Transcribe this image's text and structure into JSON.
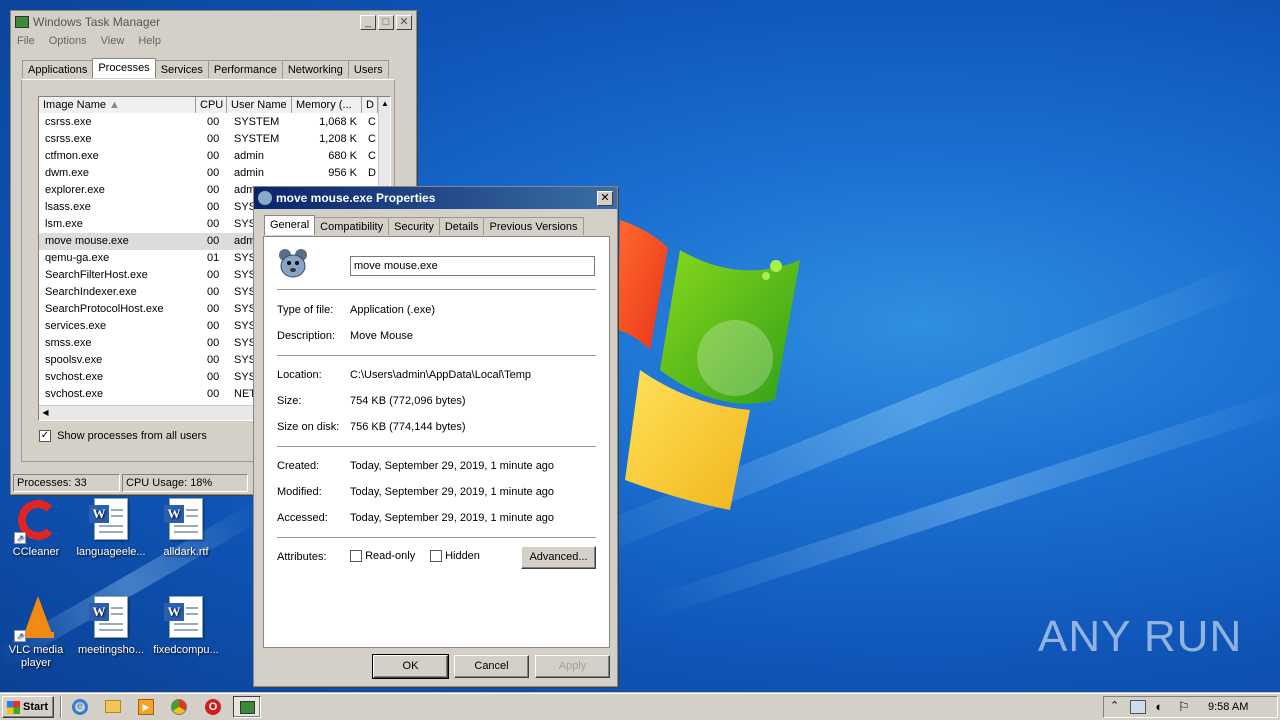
{
  "desktop": {
    "icons": [
      {
        "label": "CCleaner"
      },
      {
        "label": "languageele..."
      },
      {
        "label": "alldark.rtf"
      },
      {
        "label": "VLC media player"
      },
      {
        "label": "meetingsho..."
      },
      {
        "label": "fixedcompu..."
      }
    ],
    "watermark": "ANY RUN"
  },
  "taskmgr": {
    "title": "Windows Task Manager",
    "menu": [
      "File",
      "Options",
      "View",
      "Help"
    ],
    "tabs": [
      "Applications",
      "Processes",
      "Services",
      "Performance",
      "Networking",
      "Users"
    ],
    "active_tab": "Processes",
    "columns": [
      "Image Name",
      "CPU",
      "User Name",
      "Memory (...",
      "D"
    ],
    "rows": [
      {
        "name": "csrss.exe",
        "cpu": "00",
        "user": "SYSTEM",
        "mem": "1,068 K",
        "d": "C"
      },
      {
        "name": "csrss.exe",
        "cpu": "00",
        "user": "SYSTEM",
        "mem": "1,208 K",
        "d": "C"
      },
      {
        "name": "ctfmon.exe",
        "cpu": "00",
        "user": "admin",
        "mem": "680 K",
        "d": "C"
      },
      {
        "name": "dwm.exe",
        "cpu": "00",
        "user": "admin",
        "mem": "956 K",
        "d": "D"
      },
      {
        "name": "explorer.exe",
        "cpu": "00",
        "user": "adm",
        "mem": "",
        "d": ""
      },
      {
        "name": "lsass.exe",
        "cpu": "00",
        "user": "SYS",
        "mem": "",
        "d": ""
      },
      {
        "name": "lsm.exe",
        "cpu": "00",
        "user": "SYS",
        "mem": "",
        "d": ""
      },
      {
        "name": "move mouse.exe",
        "cpu": "00",
        "user": "adm",
        "mem": "",
        "d": ""
      },
      {
        "name": "qemu-ga.exe",
        "cpu": "01",
        "user": "SYS",
        "mem": "",
        "d": ""
      },
      {
        "name": "SearchFilterHost.exe",
        "cpu": "00",
        "user": "SYS",
        "mem": "",
        "d": ""
      },
      {
        "name": "SearchIndexer.exe",
        "cpu": "00",
        "user": "SYS",
        "mem": "",
        "d": ""
      },
      {
        "name": "SearchProtocolHost.exe",
        "cpu": "00",
        "user": "SYS",
        "mem": "",
        "d": ""
      },
      {
        "name": "services.exe",
        "cpu": "00",
        "user": "SYS",
        "mem": "",
        "d": ""
      },
      {
        "name": "smss.exe",
        "cpu": "00",
        "user": "SYS",
        "mem": "",
        "d": ""
      },
      {
        "name": "spoolsv.exe",
        "cpu": "00",
        "user": "SYS",
        "mem": "",
        "d": ""
      },
      {
        "name": "svchost.exe",
        "cpu": "00",
        "user": "SYS",
        "mem": "",
        "d": ""
      },
      {
        "name": "svchost.exe",
        "cpu": "00",
        "user": "NET",
        "mem": "",
        "d": ""
      }
    ],
    "selected_row": 7,
    "show_all_label": "Show processes from all users",
    "status_processes": "Processes: 33",
    "status_cpu": "CPU Usage: 18%"
  },
  "props": {
    "title": "move mouse.exe Properties",
    "tabs": [
      "General",
      "Compatibility",
      "Security",
      "Details",
      "Previous Versions"
    ],
    "filename": "move mouse.exe",
    "fields1": [
      {
        "label": "Type of file:",
        "value": "Application (.exe)"
      },
      {
        "label": "Description:",
        "value": "Move Mouse"
      }
    ],
    "fields2": [
      {
        "label": "Location:",
        "value": "C:\\Users\\admin\\AppData\\Local\\Temp"
      },
      {
        "label": "Size:",
        "value": "754 KB (772,096 bytes)"
      },
      {
        "label": "Size on disk:",
        "value": "756 KB (774,144 bytes)"
      }
    ],
    "fields3": [
      {
        "label": "Created:",
        "value": "Today, September 29, 2019, 1 minute ago"
      },
      {
        "label": "Modified:",
        "value": "Today, September 29, 2019, 1 minute ago"
      },
      {
        "label": "Accessed:",
        "value": "Today, September 29, 2019, 1 minute ago"
      }
    ],
    "attributes_label": "Attributes:",
    "readonly_label": "Read-only",
    "hidden_label": "Hidden",
    "advanced_label": "Advanced...",
    "ok_label": "OK",
    "cancel_label": "Cancel",
    "apply_label": "Apply"
  },
  "taskbar": {
    "start_label": "Start",
    "clock": "9:58 AM"
  }
}
